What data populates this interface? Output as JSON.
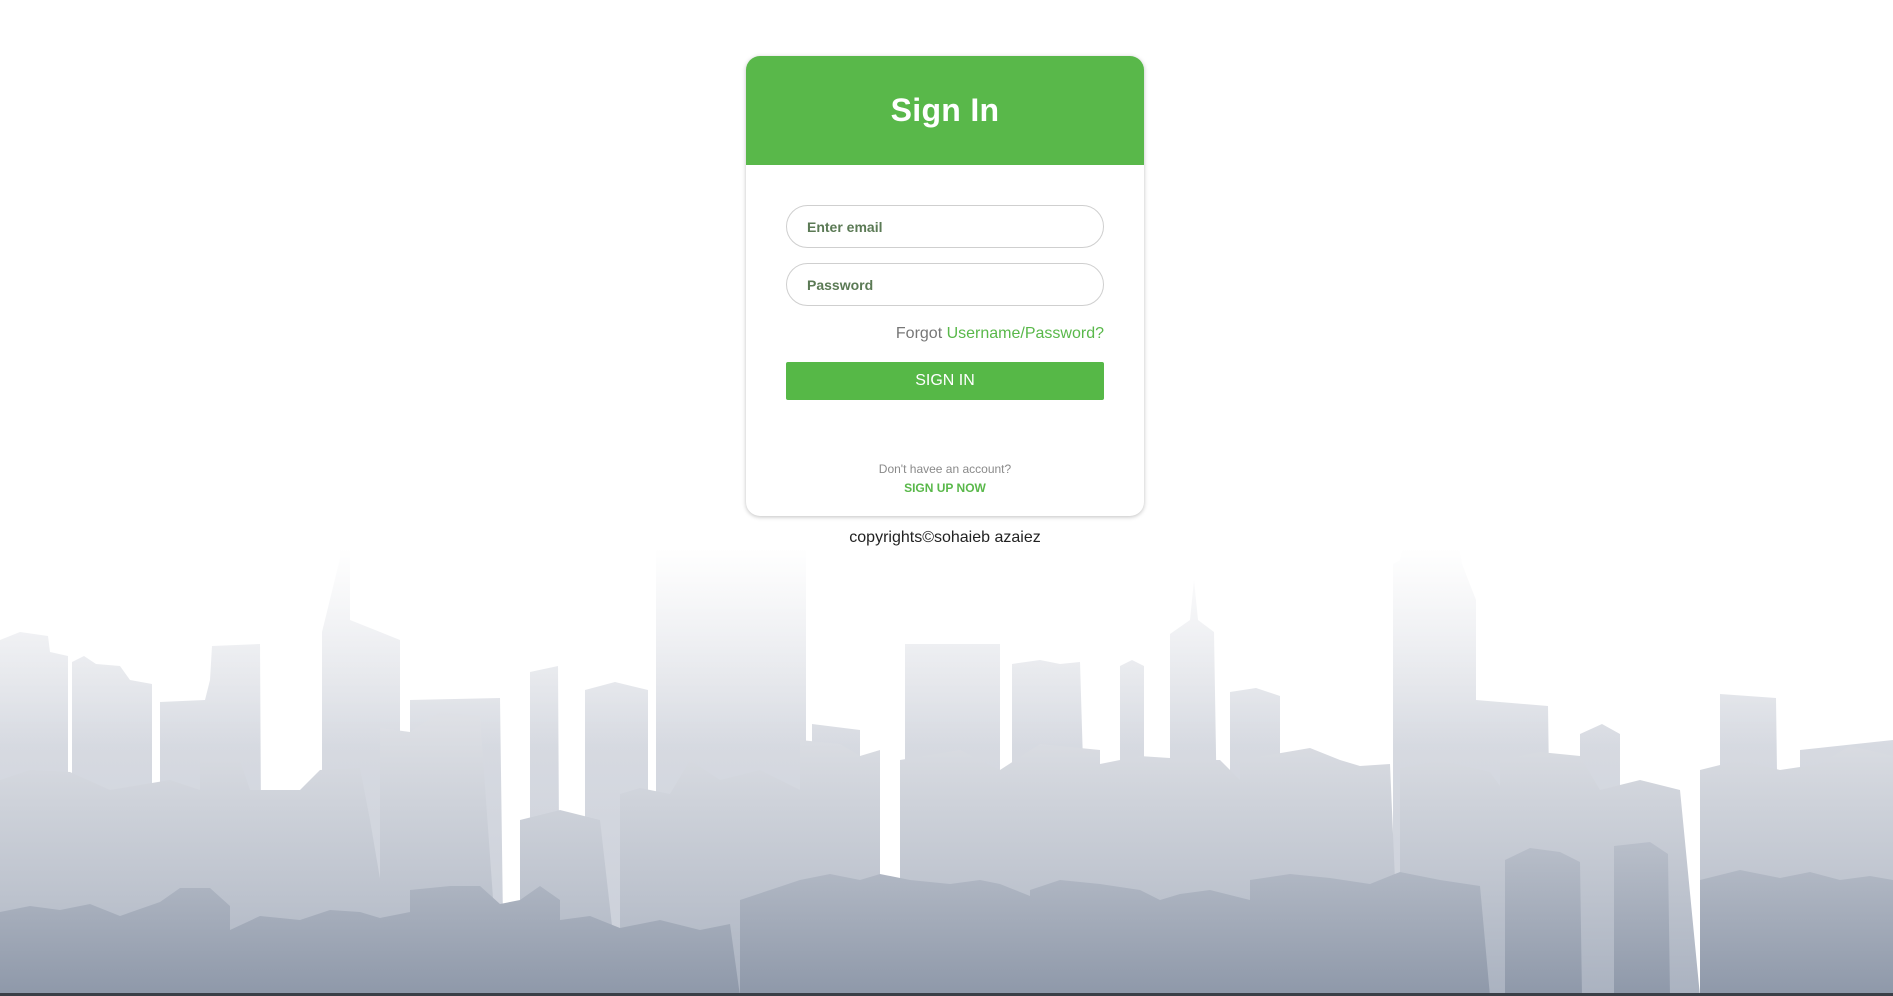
{
  "login": {
    "title": "Sign In",
    "email_placeholder": "Enter email",
    "password_placeholder": "Password",
    "forgot_prefix": "Forgot",
    "forgot_link": "Username/Password?",
    "signin_label": "SIGN IN",
    "no_account_text": "Don't havee an account?",
    "signup_label": "SIGN UP NOW"
  },
  "footer": {
    "copyright": "copyrights©sohaieb azaiez"
  },
  "colors": {
    "accent": "#59b84a",
    "skyline_light": "#ececef",
    "skyline_dark": "#9aa3b2"
  }
}
